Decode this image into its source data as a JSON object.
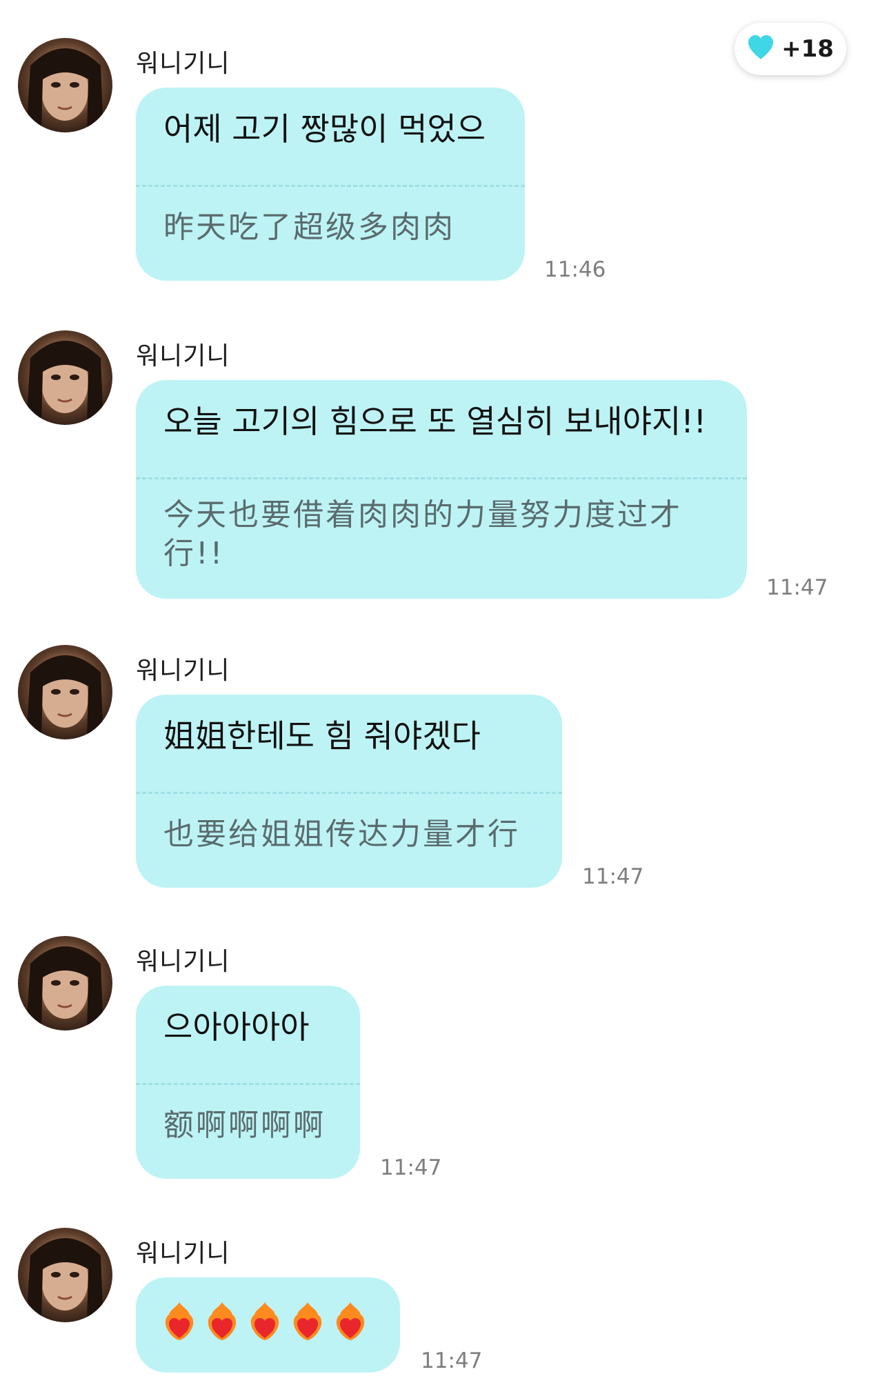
{
  "badge": {
    "count": "+18",
    "icon": "heart-icon",
    "color": "#3fd6e6"
  },
  "messages": [
    {
      "sender": "워니기니",
      "ko": "어제 고기 짱많이 먹었으",
      "zh": "昨天吃了超级多肉肉",
      "time": "11:46"
    },
    {
      "sender": "워니기니",
      "ko": "오늘 고기의 힘으로 또 열심히 보내야지!!",
      "zh": "今天也要借着肉肉的力量努力度过才行!!",
      "time": "11:47"
    },
    {
      "sender": "워니기니",
      "ko": "姐姐한테도 힘 줘야겠다",
      "zh": "也要给姐姐传达力量才行",
      "time": "11:47"
    },
    {
      "sender": "워니기니",
      "ko": "으아아아아",
      "zh": "额啊啊啊啊",
      "time": "11:47"
    },
    {
      "sender": "워니기니",
      "emoji": "heart-on-fire-icon",
      "emoji_count": 5,
      "time": "11:47"
    }
  ],
  "colors": {
    "bubble": "#bdf3f5",
    "divider": "#9fdfe3",
    "translation": "#5a6b6e"
  }
}
